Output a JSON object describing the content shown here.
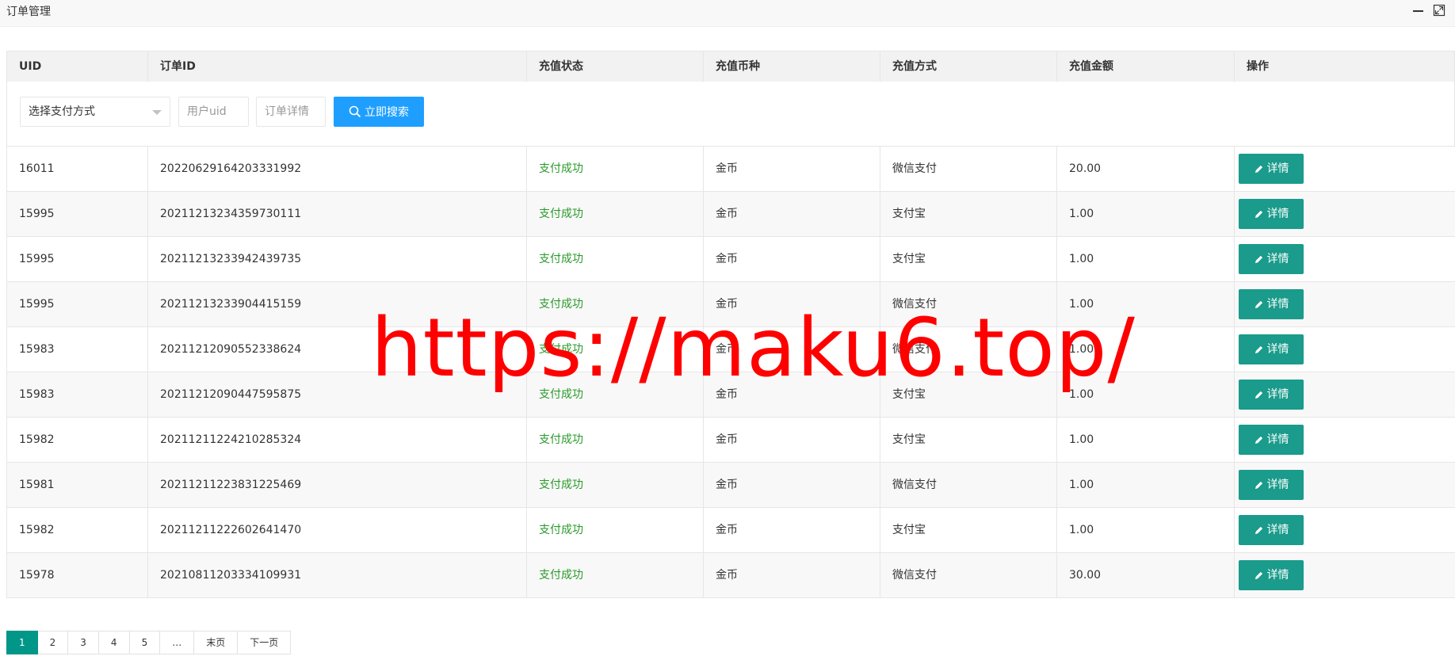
{
  "window": {
    "title": "订单管理"
  },
  "table": {
    "headers": [
      "UID",
      "订单ID",
      "充值状态",
      "充值币种",
      "充值方式",
      "充值金额",
      "操作"
    ],
    "rows": [
      {
        "uid": "16011",
        "order_id": "20220629164203331992",
        "status": "支付成功",
        "currency": "金币",
        "method": "微信支付",
        "amount": "20.00"
      },
      {
        "uid": "15995",
        "order_id": "20211213234359730111",
        "status": "支付成功",
        "currency": "金币",
        "method": "支付宝",
        "amount": "1.00"
      },
      {
        "uid": "15995",
        "order_id": "20211213233942439735",
        "status": "支付成功",
        "currency": "金币",
        "method": "支付宝",
        "amount": "1.00"
      },
      {
        "uid": "15995",
        "order_id": "20211213233904415159",
        "status": "支付成功",
        "currency": "金币",
        "method": "微信支付",
        "amount": "1.00"
      },
      {
        "uid": "15983",
        "order_id": "20211212090552338624",
        "status": "支付成功",
        "currency": "金币",
        "method": "微信支付",
        "amount": "1.00"
      },
      {
        "uid": "15983",
        "order_id": "20211212090447595875",
        "status": "支付成功",
        "currency": "金币",
        "method": "支付宝",
        "amount": "1.00"
      },
      {
        "uid": "15982",
        "order_id": "20211211224210285324",
        "status": "支付成功",
        "currency": "金币",
        "method": "支付宝",
        "amount": "1.00"
      },
      {
        "uid": "15981",
        "order_id": "20211211223831225469",
        "status": "支付成功",
        "currency": "金币",
        "method": "微信支付",
        "amount": "1.00"
      },
      {
        "uid": "15982",
        "order_id": "20211211222602641470",
        "status": "支付成功",
        "currency": "金币",
        "method": "支付宝",
        "amount": "1.00"
      },
      {
        "uid": "15978",
        "order_id": "20210811203334109931",
        "status": "支付成功",
        "currency": "金币",
        "method": "微信支付",
        "amount": "30.00"
      }
    ],
    "detail_label": "详情"
  },
  "filters": {
    "payment_select": "选择支付方式",
    "uid_placeholder": "用户uid",
    "detail_placeholder": "订单详情",
    "search_label": "立即搜索"
  },
  "pagination": {
    "pages": [
      "1",
      "2",
      "3",
      "4",
      "5",
      "…",
      "末页",
      "下一页"
    ],
    "current": "1"
  },
  "watermark": "https://maku6.top/",
  "colors": {
    "status_green": "#2a9a2a",
    "detail_button": "#1a9b8b",
    "search_button": "#1e9fff",
    "page_active": "#009688",
    "watermark": "#ff0000"
  }
}
